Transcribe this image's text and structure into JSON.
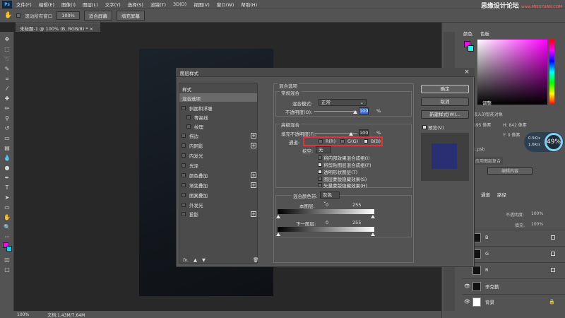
{
  "menubar": {
    "logo": "Ps",
    "items": [
      "文件(F)",
      "编辑(E)",
      "图像(I)",
      "图层(L)",
      "文字(Y)",
      "选择(S)",
      "滤镜(T)",
      "3D(D)",
      "视图(V)",
      "窗口(W)",
      "帮助(H)"
    ],
    "watermark": "思缘设计论坛",
    "watermark_url": "www.MISSYUAN.COM"
  },
  "optionsbar": {
    "scroll_all_label": "滚动所有窗口",
    "zoom_btn": "100%",
    "fit_screen_btn": "适合屏幕",
    "fill_screen_btn": "填充屏幕"
  },
  "document": {
    "tab_title": "未标题-1 @ 100% (B, RGB/8) *"
  },
  "statusbar": {
    "zoom": "100%",
    "doc_info": "文档:1.43M/7.64M"
  },
  "panels": {
    "color_tab": "颜色",
    "swatches_tab": "色板",
    "adjust_tab": "调整",
    "properties_partial": "嵌入的智能对象",
    "w_label": "595 像素",
    "h_label": "H: 842 像素",
    "x_label": "Y: 0 像素",
    "file_label": "1.psb",
    "comp_label": "应用图层复合",
    "edit_content": "编辑内容",
    "gauge": {
      "percent": "49%",
      "up": "0.5K/s",
      "down": "1.6K/s"
    },
    "channels_tab": "通道",
    "paths_tab": "路径",
    "opacity_label": "不透明度:",
    "opacity_value": "100%",
    "fill_label": "填充:",
    "fill_value": "100%",
    "layers": [
      {
        "name": "B"
      },
      {
        "name": "G"
      },
      {
        "name": "R"
      },
      {
        "name": "李克勤"
      },
      {
        "name": "背景"
      }
    ]
  },
  "dialog": {
    "title": "图层样式",
    "styles_header": "样式",
    "blend_options_item": "混合选项",
    "style_items": [
      "斜面和浮雕",
      "等高线",
      "纹理",
      "描边",
      "内阴影",
      "内发光",
      "光泽",
      "颜色叠加",
      "渐变叠加",
      "图案叠加",
      "外发光",
      "投影"
    ],
    "fx_label": "fx.",
    "section_blend": "混合选项",
    "section_general": "常规混合",
    "blend_mode_label": "混合模式:",
    "blend_mode_value": "正常",
    "opacity_label": "不透明度(O):",
    "opacity_value": "100",
    "percent": "%",
    "section_advanced": "高级混合",
    "fill_opacity_label": "填充不透明度(F):",
    "fill_opacity_value": "100",
    "channels_label": "通道:",
    "channel_r": "R(R)",
    "channel_g": "G(G)",
    "channel_b": "B(B)",
    "knockout_label": "挖空:",
    "knockout_value": "无",
    "options": [
      {
        "label": "将内部效果混合成组(I)",
        "checked": false
      },
      {
        "label": "将剪贴图层混合成组(P)",
        "checked": true
      },
      {
        "label": "透明形状图层(T)",
        "checked": true
      },
      {
        "label": "图层蒙版隐藏效果(S)",
        "checked": false
      },
      {
        "label": "矢量蒙版隐藏效果(H)",
        "checked": false
      }
    ],
    "blend_if_label": "混合颜色带:",
    "blend_if_value": "灰色",
    "this_layer_label": "本图层:",
    "this_layer_min": "0",
    "this_layer_max": "255",
    "under_layer_label": "下一图层:",
    "under_layer_min": "0",
    "under_layer_max": "255",
    "ok_btn": "确定",
    "cancel_btn": "取消",
    "new_style_btn": "新建样式(W)...",
    "preview_label": "预览(V)",
    "preview_color": "#2a2e72"
  }
}
